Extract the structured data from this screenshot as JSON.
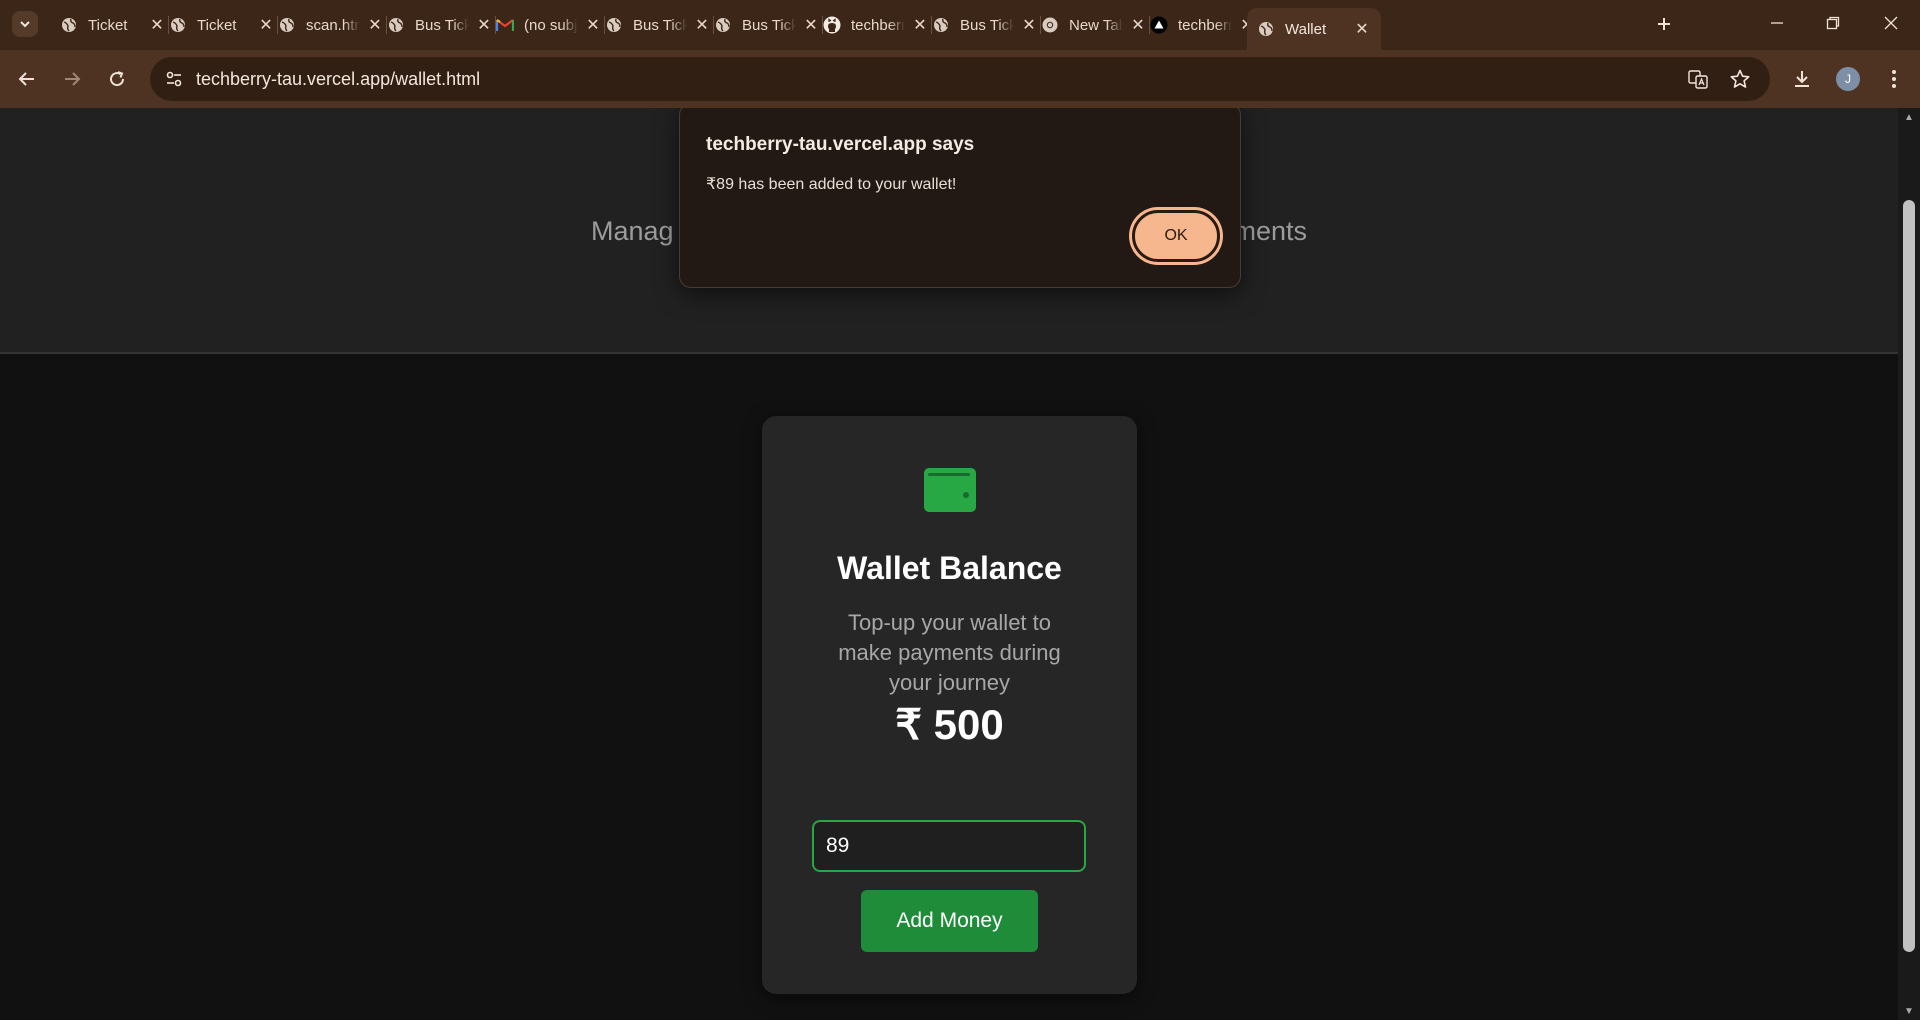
{
  "browser": {
    "tabs": [
      {
        "title": "Ticket",
        "icon": "globe-icon"
      },
      {
        "title": "Ticket",
        "icon": "globe-icon"
      },
      {
        "title": "scan.html",
        "icon": "globe-icon"
      },
      {
        "title": "Bus Ticket",
        "icon": "globe-icon"
      },
      {
        "title": "(no subject)",
        "icon": "gmail-icon"
      },
      {
        "title": "Bus Ticket",
        "icon": "globe-icon"
      },
      {
        "title": "Bus Ticket",
        "icon": "globe-icon"
      },
      {
        "title": "techberry",
        "icon": "github-icon"
      },
      {
        "title": "Bus Ticket",
        "icon": "globe-icon"
      },
      {
        "title": "New Tab",
        "icon": "chrome-icon"
      },
      {
        "title": "techberry",
        "icon": "vercel-icon"
      },
      {
        "title": "Wallet",
        "icon": "globe-icon",
        "active": true
      }
    ],
    "url": "techberry-tau.vercel.app/wallet.html",
    "profile_initial": "J",
    "accent_color": "#3b2618"
  },
  "page": {
    "hero_subtitle_left": "Manag",
    "hero_subtitle_right": "ments",
    "wallet": {
      "title": "Wallet Balance",
      "description": "Top-up your wallet to make payments during your journey",
      "balance": "₹ 500",
      "input_value": "89",
      "button_label": "Add Money",
      "accent_color": "#28a745"
    }
  },
  "dialog": {
    "title": "techberry-tau.vercel.app says",
    "message": "₹89 has been added to your wallet!",
    "ok_label": "OK"
  }
}
